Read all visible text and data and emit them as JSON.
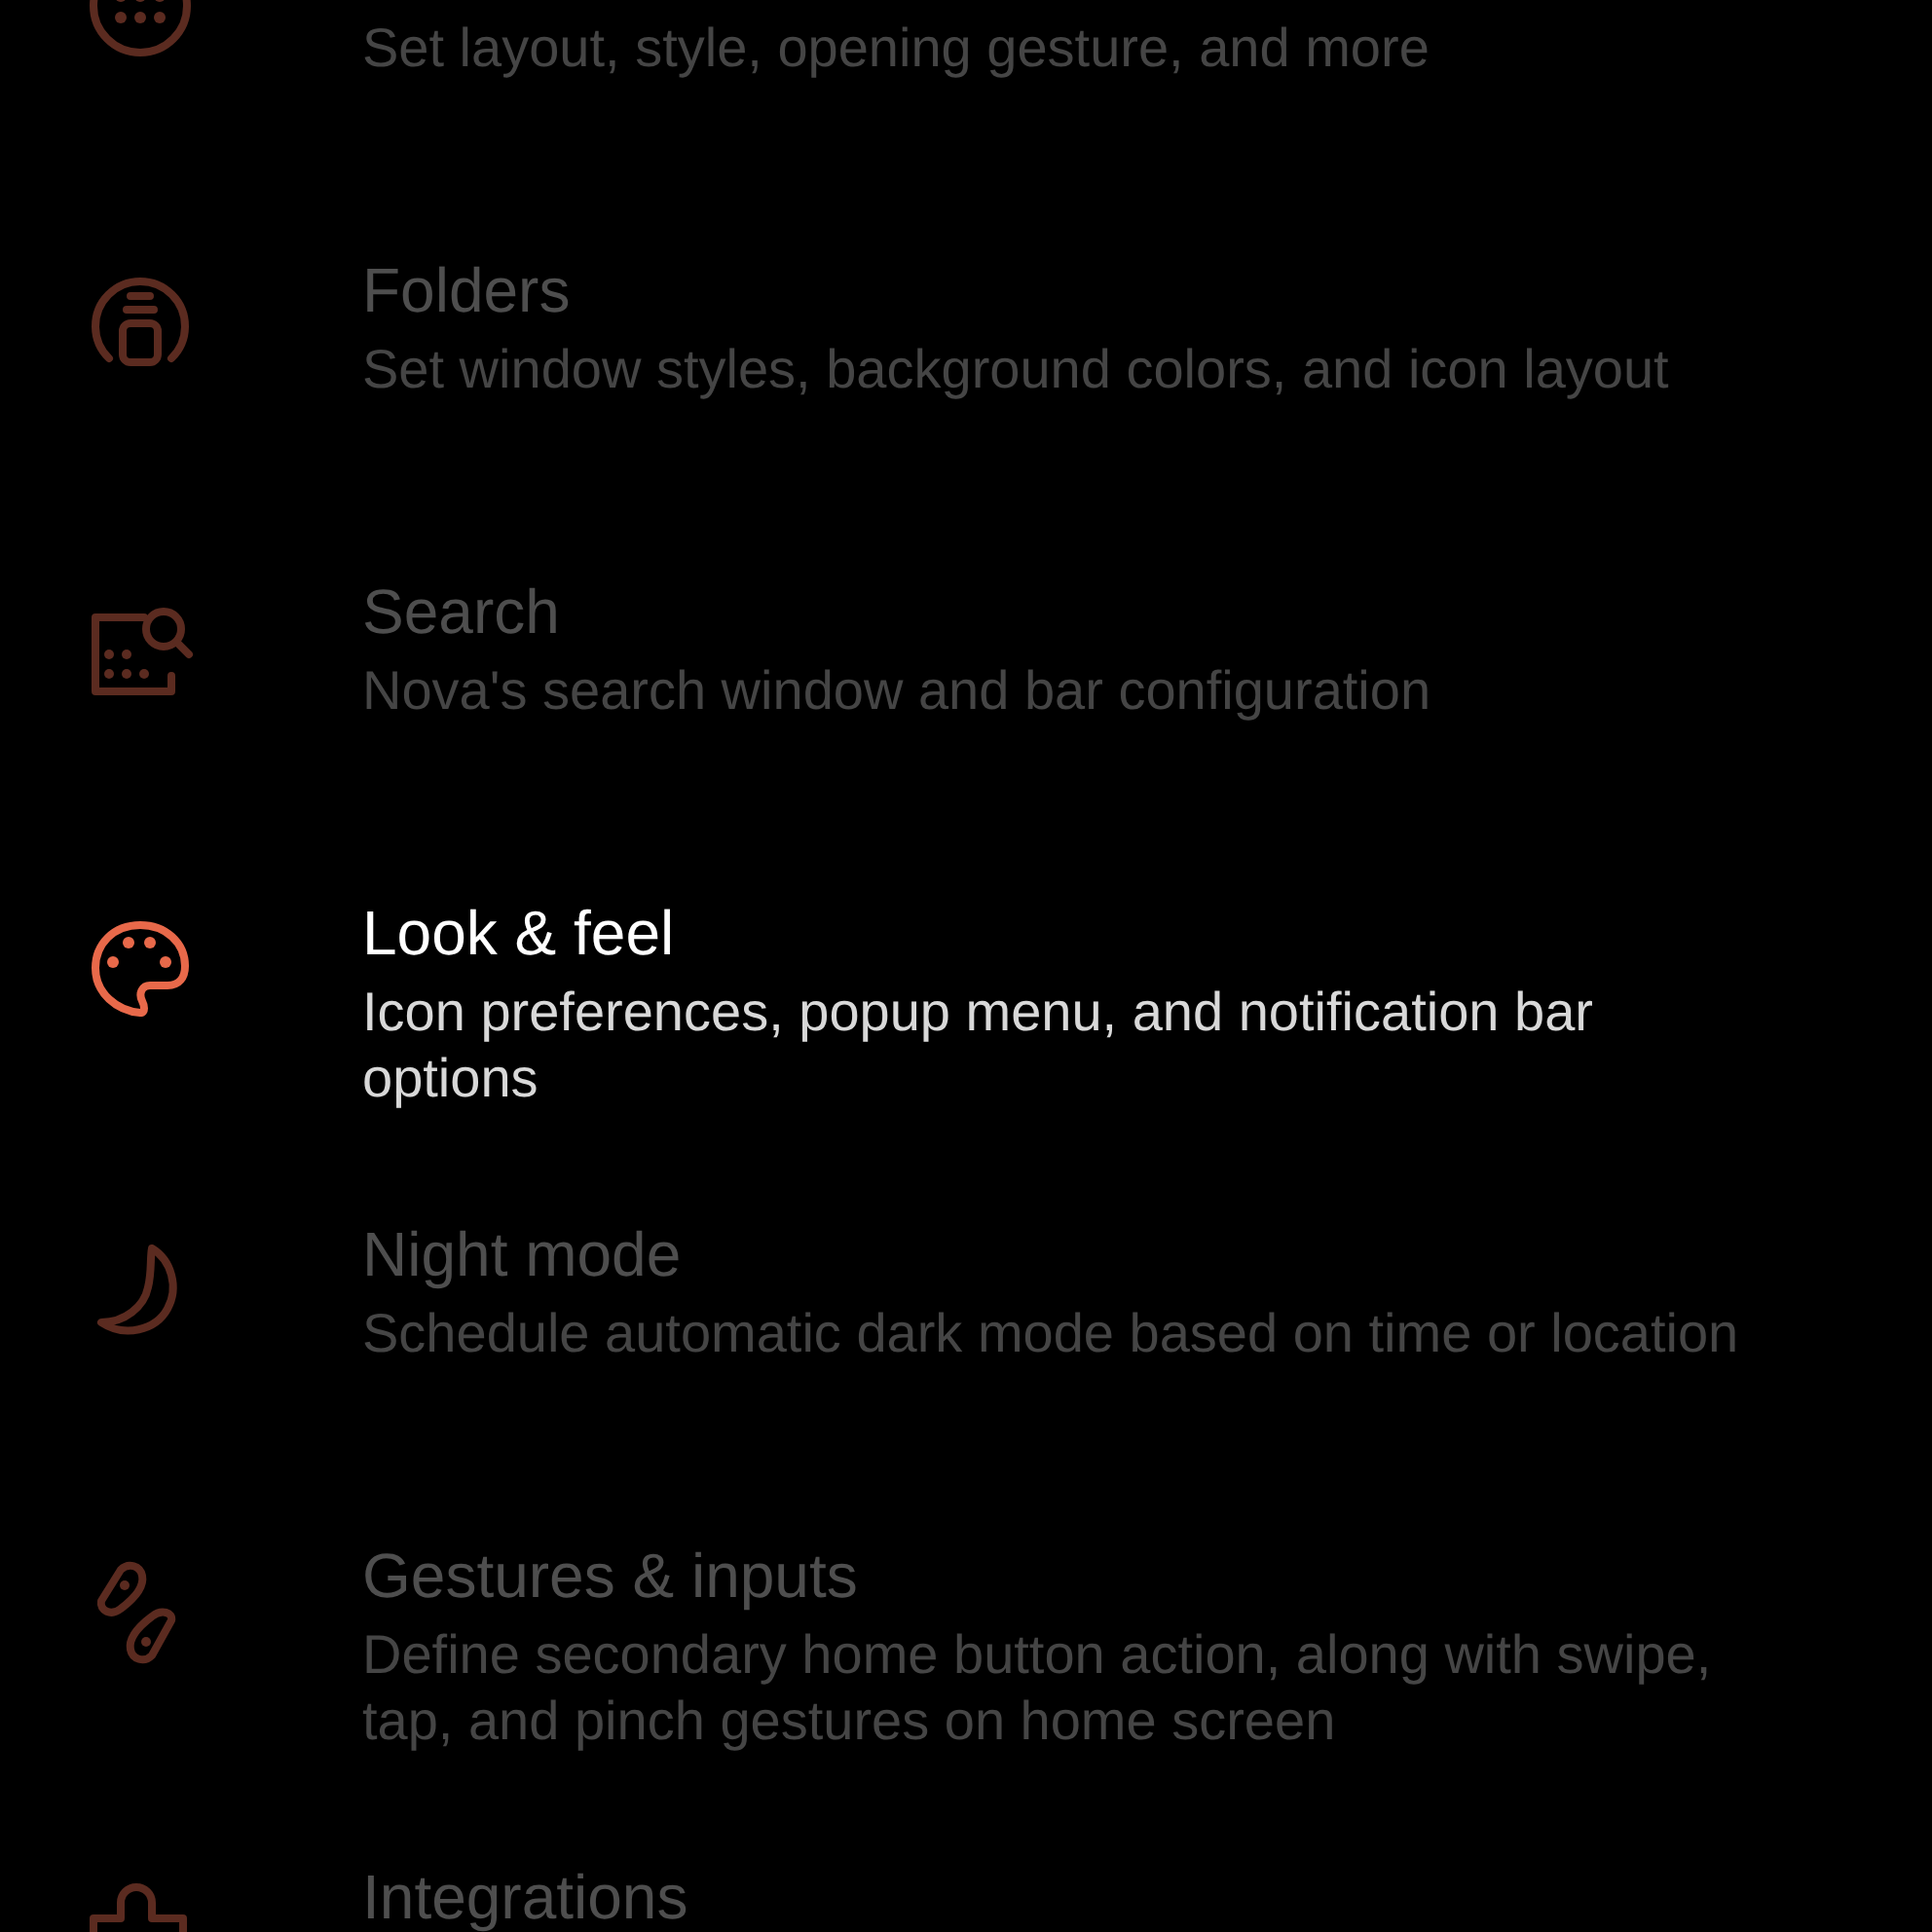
{
  "settings_items": [
    {
      "subtitle": "Set layout, style, opening gesture, and more",
      "selected": false
    },
    {
      "title": "Folders",
      "subtitle": "Set window styles, background colors, and icon layout",
      "selected": false
    },
    {
      "title": "Search",
      "subtitle": "Nova's search window and bar configuration",
      "selected": false
    },
    {
      "title": "Look & feel",
      "subtitle": "Icon preferences, popup menu, and notification bar options",
      "selected": true
    },
    {
      "title": "Night mode",
      "subtitle": "Schedule automatic dark mode based on time or location",
      "selected": false
    },
    {
      "title": "Gestures & inputs",
      "subtitle": "Define secondary home button action, along with swipe, tap, and pinch gestures on home screen",
      "selected": false
    },
    {
      "title": "Integrations",
      "selected": false
    }
  ]
}
